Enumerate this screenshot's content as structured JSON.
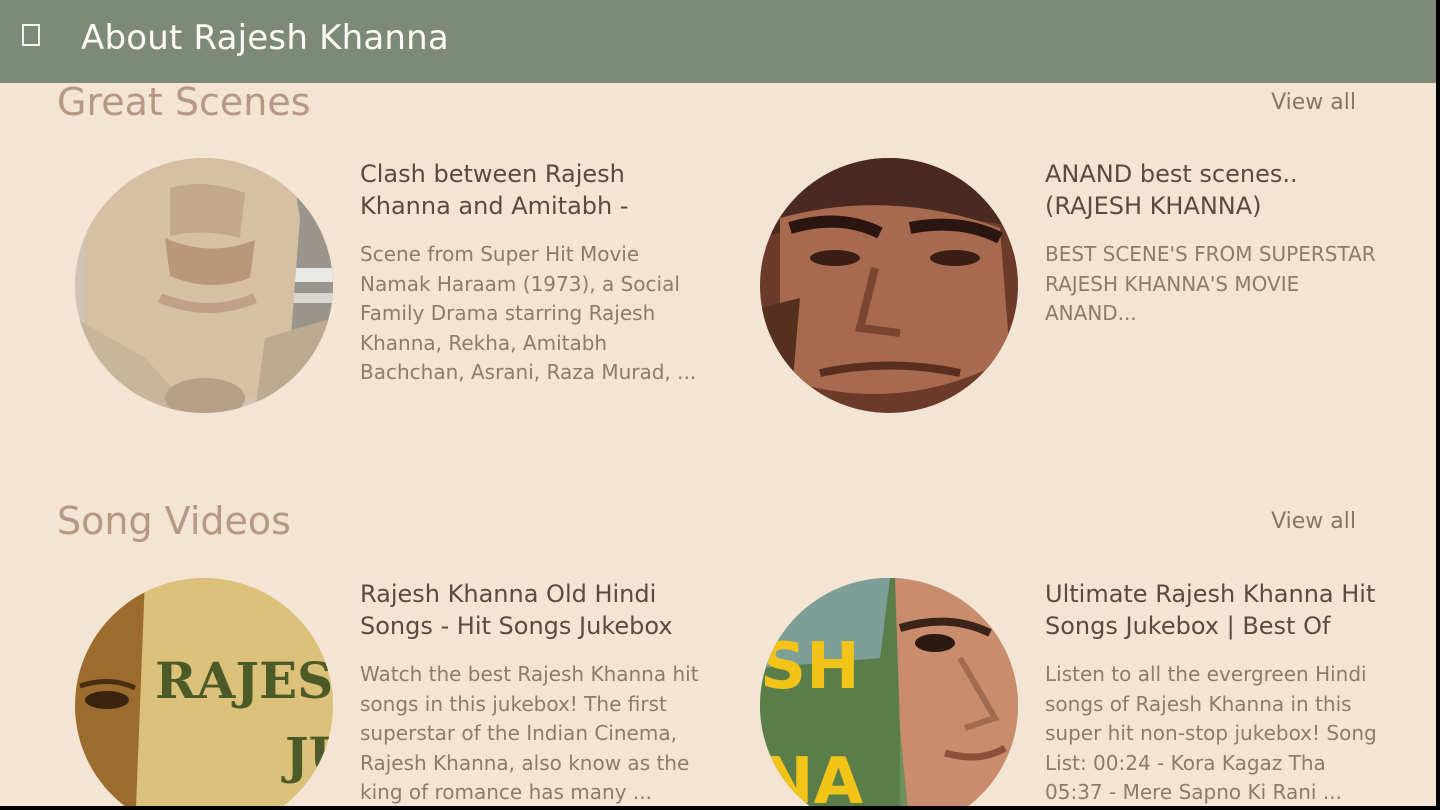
{
  "app": {
    "title": "About Rajesh Khanna",
    "menu_icon": "hamburger-menu-icon"
  },
  "colors": {
    "titlebar": "#7e8a78",
    "background": "#f3e4d3",
    "section_title": "#b59886"
  },
  "sections": [
    {
      "title": "Great Scenes",
      "view_all": "View all",
      "items": [
        {
          "title": "Clash between Rajesh Khanna and Amitabh - Namak Haraam Scene",
          "description": "Scene from Super Hit Movie Namak Haraam (1973), a Social Family Drama starring Rajesh Khanna, Rekha, Amitabh Bachchan, Asrani, Raza Murad, ..."
        },
        {
          "title": "ANAND best scenes.. (RAJESH KHANNA)",
          "description": "BEST SCENE'S FROM SUPERSTAR RAJESH KHANNA'S MOVIE ANAND..."
        }
      ]
    },
    {
      "title": "Song Videos",
      "view_all": "View all",
      "items": [
        {
          "title": "Rajesh Khanna Old Hindi Songs - Hit Songs Jukebox Collection - Evergreen",
          "description": "Watch the best Rajesh Khanna hit songs in this jukebox! The first superstar of the Indian Cinema, Rajesh Khanna, also know as the king of romance has many ...",
          "thumb_text": [
            "RAJES",
            "JU"
          ]
        },
        {
          "title": "Ultimate Rajesh Khanna Hit Songs Jukebox | Best Of Bollywood Old Hindi Songs",
          "description": "Listen to all the evergreen Hindi songs of Rajesh Khanna in this super hit non-stop jukebox! Song List: 00:24 - Kora Kagaz Tha 05:37 - Mere Sapno Ki Rani ...",
          "thumb_text": [
            "SH",
            "NA"
          ]
        }
      ]
    }
  ]
}
